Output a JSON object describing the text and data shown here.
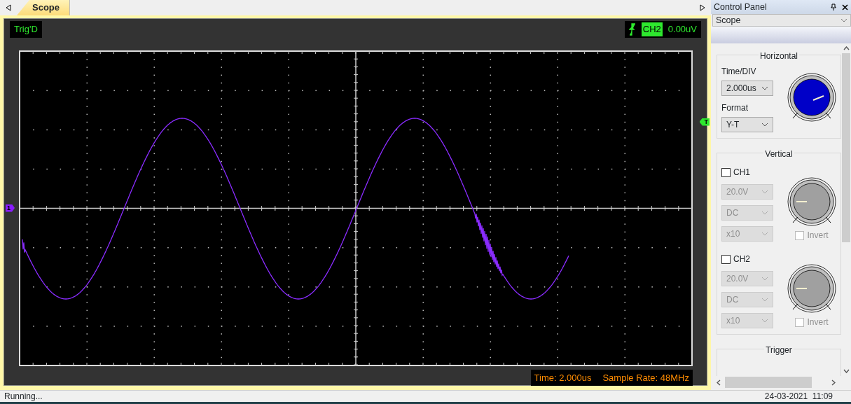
{
  "tabs": [
    {
      "label": "Scope",
      "selected": true
    }
  ],
  "scope": {
    "trigger_status": "Trig'D",
    "trigger_channel": "CH2",
    "trigger_level": "0.00uV",
    "channel_marker": "1",
    "trigger_marker": "T",
    "time": "Time: 2.000us",
    "sample_rate": "Sample Rate: 48MHz"
  },
  "control_panel": {
    "title": "Control Panel",
    "view": "Scope",
    "horizontal": {
      "title": "Horizontal",
      "fields": [
        {
          "label": "Time/DIV",
          "value": "2.000us"
        },
        {
          "label": "Format",
          "value": "Y-T"
        }
      ]
    },
    "vertical": {
      "title": "Vertical",
      "channels": [
        {
          "name": "CH1",
          "checked": false,
          "disabled": true,
          "volts": "20.0V",
          "coupling": "DC",
          "probe": "x10",
          "invert": "Invert",
          "invert_checked": false
        },
        {
          "name": "CH2",
          "checked": false,
          "disabled": true,
          "volts": "20.0V",
          "coupling": "DC",
          "probe": "x10",
          "invert": "Invert",
          "invert_checked": false
        }
      ]
    },
    "trigger": {
      "title": "Trigger"
    }
  },
  "status_bar": {
    "message": "Running...",
    "datetime": "24-03-2021  11:09"
  }
}
